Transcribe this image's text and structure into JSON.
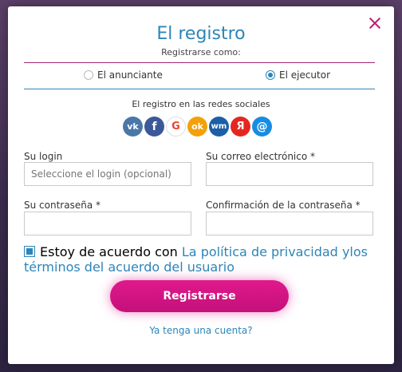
{
  "modal": {
    "title": "El registro",
    "subtitle": "Registrarse como:"
  },
  "roles": {
    "advertiser": "El anunciante",
    "performer": "El ejecutor",
    "selected": "performer"
  },
  "social": {
    "label": "El registro en las redes sociales",
    "icons": [
      {
        "name": "vk-icon",
        "glyph": "vk",
        "color": "#4a76a8"
      },
      {
        "name": "facebook-icon",
        "glyph": "f",
        "color": "#3b5998"
      },
      {
        "name": "google-icon",
        "glyph": "G",
        "color": "#ffffff"
      },
      {
        "name": "odnoklassniki-icon",
        "glyph": "ok",
        "color": "#f2a10a"
      },
      {
        "name": "webmoney-icon",
        "glyph": "wm",
        "color": "#1a5fa8"
      },
      {
        "name": "yandex-icon",
        "glyph": "Я",
        "color": "#e52620"
      },
      {
        "name": "mail-icon",
        "glyph": "@",
        "color": "#168de2"
      }
    ]
  },
  "form": {
    "login_label": "Su login",
    "login_placeholder": "Seleccione el login (opcional)",
    "email_label": "Su correo electrónico *",
    "password_label": "Su contraseña *",
    "confirm_label": "Confirmación de la contraseña *"
  },
  "agreement": {
    "text": "Estoy de acuerdo con",
    "privacy_link": "La política de privacidad",
    "terms_link": "ylos términos del acuerdo del usuario"
  },
  "submit_label": "Registrarse",
  "login_link": "Ya tenga una cuenta?"
}
